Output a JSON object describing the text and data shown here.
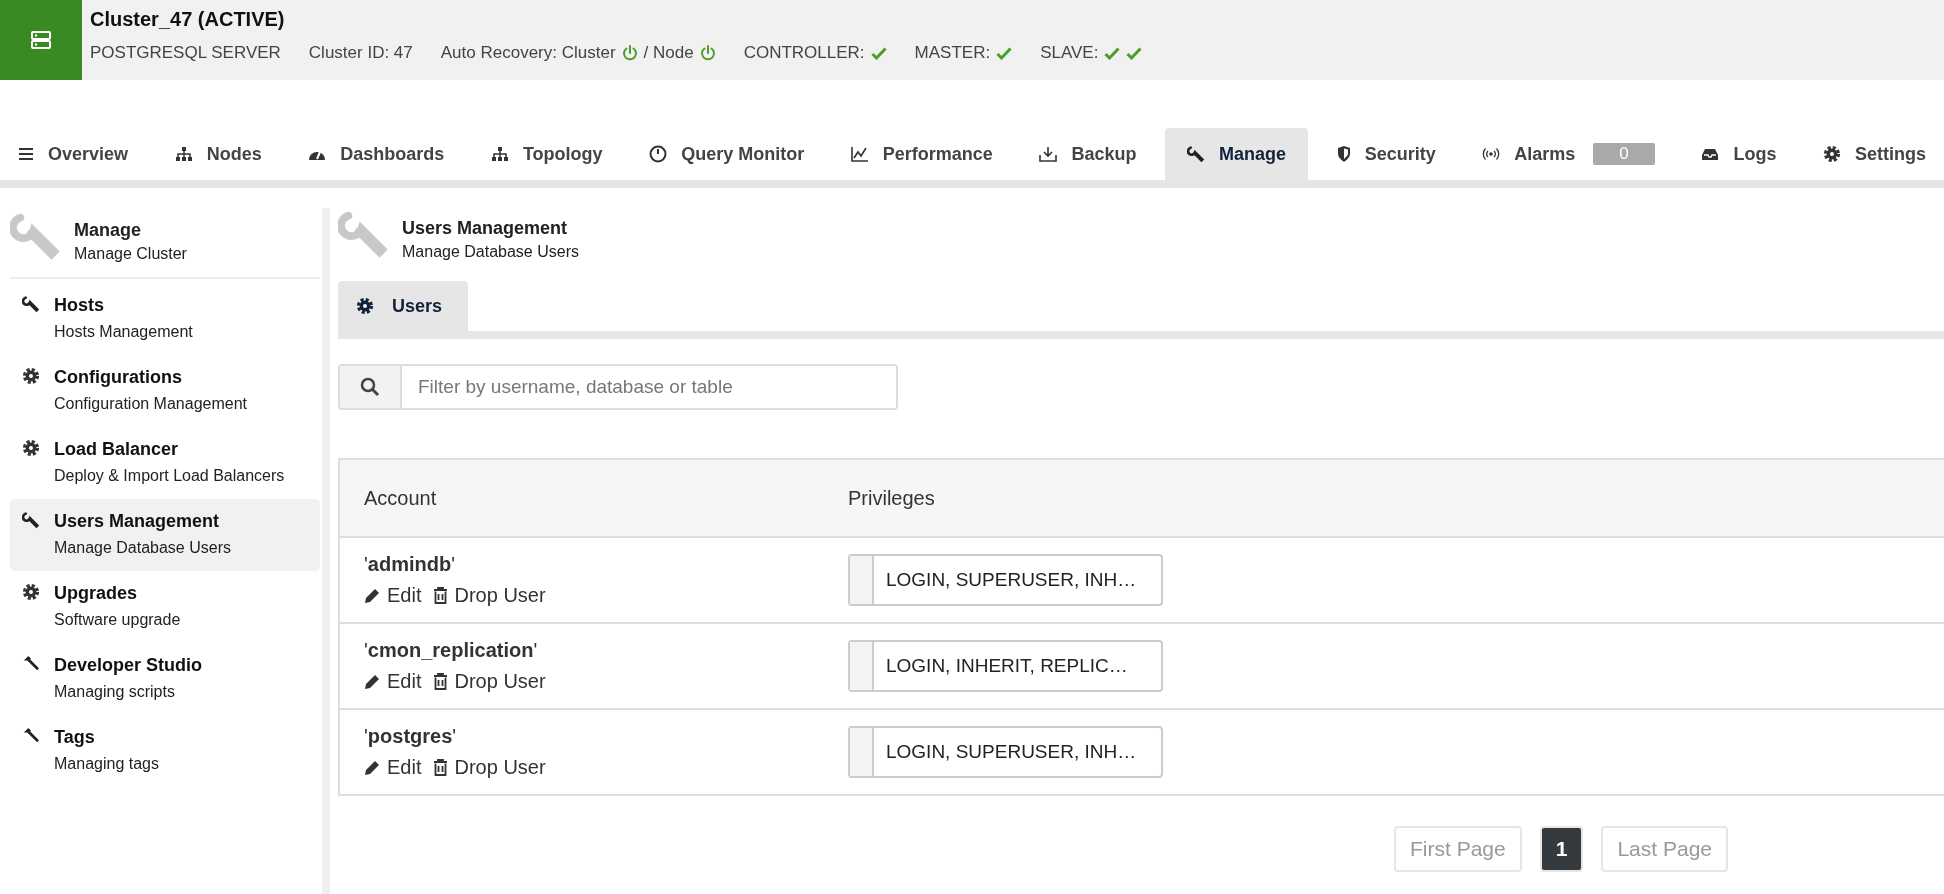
{
  "header": {
    "title": "Cluster_47 (ACTIVE)",
    "server_type": "POSTGRESQL SERVER",
    "cluster_id": "Cluster ID: 47",
    "auto_recovery": {
      "label": "Auto Recovery: Cluster",
      "cluster_on": true,
      "separator": "/ Node",
      "node_on": true
    },
    "roles": [
      {
        "label": "CONTROLLER:",
        "checks": [
          true
        ]
      },
      {
        "label": "MASTER:",
        "checks": [
          true
        ]
      },
      {
        "label": "SLAVE:",
        "checks": [
          true,
          true
        ]
      }
    ]
  },
  "tabs": [
    {
      "label": "Overview",
      "selected": false
    },
    {
      "label": "Nodes",
      "selected": false
    },
    {
      "label": "Dashboards",
      "selected": false
    },
    {
      "label": "Topology",
      "selected": false
    },
    {
      "label": "Query Monitor",
      "selected": false
    },
    {
      "label": "Performance",
      "selected": false
    },
    {
      "label": "Backup",
      "selected": false
    },
    {
      "label": "Manage",
      "selected": true
    },
    {
      "label": "Security",
      "selected": false
    },
    {
      "label": "Alarms",
      "badge": "0",
      "selected": false
    },
    {
      "label": "Logs",
      "selected": false
    },
    {
      "label": "Settings",
      "selected": false
    }
  ],
  "sidebar": {
    "title": "Manage",
    "subtitle": "Manage Cluster",
    "items": [
      {
        "title": "Hosts",
        "subtitle": "Hosts Management",
        "selected": false
      },
      {
        "title": "Configurations",
        "subtitle": "Configuration Management",
        "selected": false
      },
      {
        "title": "Load Balancer",
        "subtitle": "Deploy & Import Load Balancers",
        "selected": false
      },
      {
        "title": "Users Management",
        "subtitle": "Manage Database Users",
        "selected": true
      },
      {
        "title": "Upgrades",
        "subtitle": "Software upgrade",
        "selected": false
      },
      {
        "title": "Developer Studio",
        "subtitle": "Managing scripts",
        "selected": false
      },
      {
        "title": "Tags",
        "subtitle": "Managing tags",
        "selected": false
      }
    ]
  },
  "main": {
    "title": "Users Management",
    "subtitle": "Manage Database Users",
    "subtabs": [
      {
        "label": "Users",
        "selected": true
      }
    ],
    "search": {
      "placeholder": "Filter by username, database or table"
    },
    "table": {
      "columns": [
        "Account",
        "Privileges"
      ],
      "rows": [
        {
          "account": "'**admindb**'",
          "actions": [
            "Edit",
            "Drop User"
          ],
          "privileges": "LOGIN, SUPERUSER, INH…"
        },
        {
          "account": "'**cmon_replication**'",
          "actions": [
            "Edit",
            "Drop User"
          ],
          "privileges": "LOGIN, INHERIT, REPLIC…"
        },
        {
          "account": "'**postgres**'",
          "actions": [
            "Edit",
            "Drop User"
          ],
          "privileges": "LOGIN, SUPERUSER, INH…"
        }
      ]
    },
    "pagination": [
      {
        "label": "First Page",
        "selected": false,
        "disabled": true
      },
      {
        "label": "1",
        "selected": true,
        "disabled": false
      },
      {
        "label": "Last Page",
        "selected": false,
        "disabled": true
      }
    ]
  }
}
